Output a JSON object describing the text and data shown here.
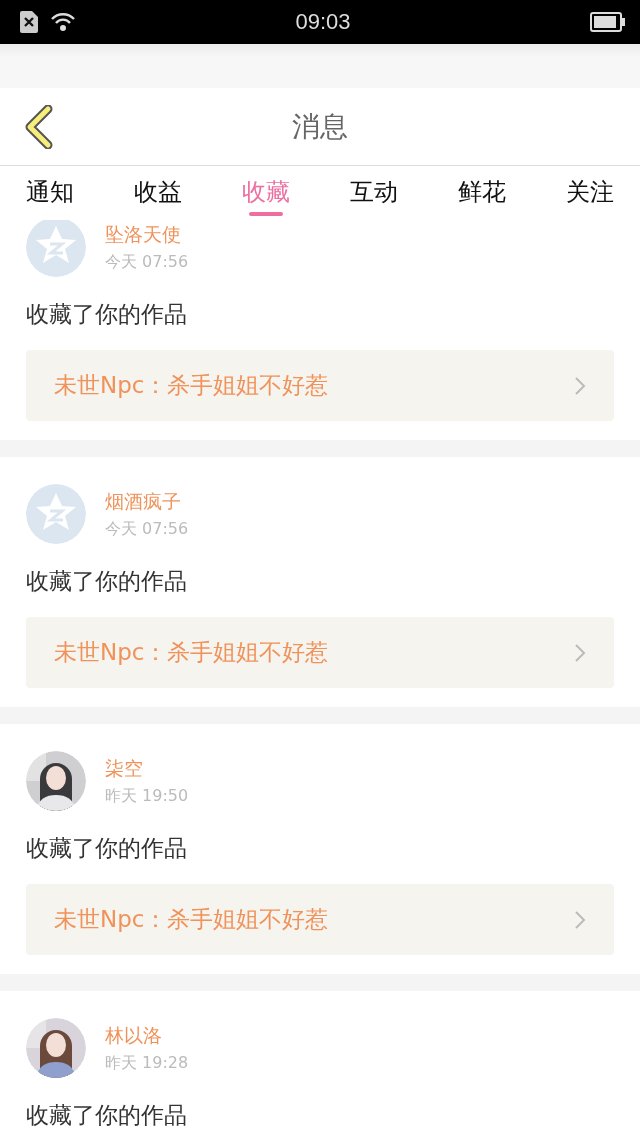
{
  "status_bar": {
    "time": "09:03"
  },
  "header": {
    "title": "消息"
  },
  "tabs": [
    {
      "label": "通知",
      "selected": false
    },
    {
      "label": "收益",
      "selected": false
    },
    {
      "label": "收藏",
      "selected": true
    },
    {
      "label": "互动",
      "selected": false
    },
    {
      "label": "鲜花",
      "selected": false
    },
    {
      "label": "关注",
      "selected": false
    }
  ],
  "messages": [
    {
      "avatar": {
        "kind": "default"
      },
      "name": "坠洛天使",
      "time": "今天 07:56",
      "text": "收藏了你的作品",
      "work": "未世Npc：杀手姐姐不好惹"
    },
    {
      "avatar": {
        "kind": "default"
      },
      "name": "烟酒疯子",
      "time": "今天 07:56",
      "text": "收藏了你的作品",
      "work": "未世Npc：杀手姐姐不好惹"
    },
    {
      "name": "柒空",
      "time": "昨天 19:50",
      "text": "收藏了你的作品",
      "work": "未世Npc：杀手姐姐不好惹"
    },
    {
      "name": "林以洛",
      "time": "昨天 19:28",
      "text": "收藏了你的作品"
    }
  ]
}
